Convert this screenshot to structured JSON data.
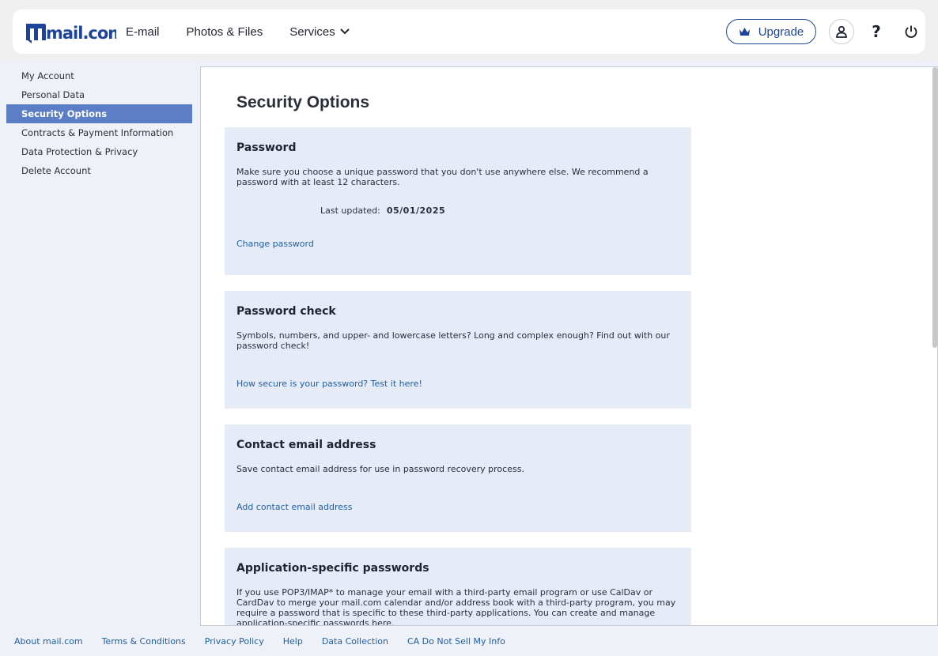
{
  "header": {
    "logo_text": "mail.com",
    "nav": [
      {
        "label": "E-mail"
      },
      {
        "label": "Photos & Files"
      },
      {
        "label": "Services"
      }
    ],
    "upgrade_label": "Upgrade",
    "help_glyph": "?",
    "icons": [
      "crown-icon",
      "user-icon",
      "help-icon",
      "power-icon",
      "chevron-down-icon"
    ],
    "brand_color": "#1c449b"
  },
  "sidebar": {
    "items": [
      {
        "label": "My Account"
      },
      {
        "label": "Personal Data"
      },
      {
        "label": "Security Options",
        "active": true
      },
      {
        "label": "Contracts & Payment Information"
      },
      {
        "label": "Data Protection & Privacy"
      },
      {
        "label": "Delete Account"
      }
    ],
    "active_color": "#5b7ec7"
  },
  "main": {
    "title": "Security Options",
    "cards": [
      {
        "heading": "Password",
        "text": "Make sure you choose a unique password that you don't use anywhere else. We recommend a password with at least 12 characters.",
        "updated_label": "Last updated:",
        "updated_value": "05/01/2025",
        "link": "Change password"
      },
      {
        "heading": "Password check",
        "text": "Symbols, numbers, and upper- and lowercase letters? Long and complex enough? Find out with our password check!",
        "link": "How secure is your password? Test it here!"
      },
      {
        "heading": "Contact email address",
        "text": "Save contact email address for use in password recovery process.",
        "link": "Add contact email address"
      },
      {
        "heading": "Application-specific passwords",
        "text": "If you use POP3/IMAP* to manage your email with a third-party email program or use CalDav or CardDav to merge your mail.com calendar and/or address book with a third-party program, you may require a password that is specific to these third-party applications. You can create and manage application-specific passwords here."
      }
    ],
    "card_color": "#e6ecf7"
  },
  "footer": {
    "links": [
      {
        "label": "About mail.com"
      },
      {
        "label": "Terms & Conditions"
      },
      {
        "label": "Privacy Policy"
      },
      {
        "label": "Help"
      },
      {
        "label": "Data Collection"
      },
      {
        "label": "CA Do Not Sell My Info"
      }
    ]
  }
}
